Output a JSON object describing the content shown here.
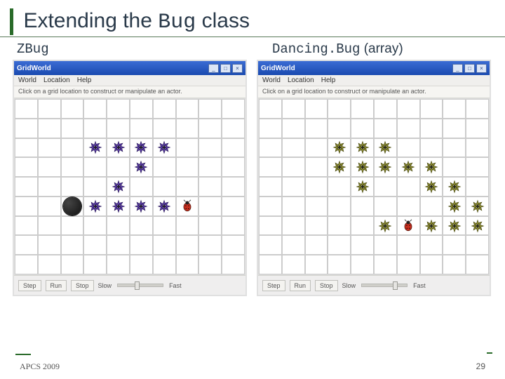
{
  "title_pre": "Extending the ",
  "title_code": "Bug",
  "title_post": " class",
  "left_label": "ZBug",
  "right_label_code": "Dancing.Bug",
  "right_label_paren": " (array)",
  "app": {
    "title": "GridWorld",
    "menu": {
      "m1": "World",
      "m2": "Location",
      "m3": "Help"
    },
    "hint": "Click on a grid location to construct or manipulate an actor.",
    "btn_step": "Step",
    "btn_run": "Run",
    "btn_stop": "Stop",
    "lbl_slow": "Slow",
    "lbl_fast": "Fast",
    "win_min": "_",
    "win_max": "□",
    "win_close": "×"
  },
  "footer": {
    "left": "APCS 2009",
    "right": "29"
  },
  "chart_data": {
    "type": "table",
    "note": "Two GridWorld windows, each a 10-col grid. Actor positions by (col,row).",
    "left_grid": {
      "cols": 10,
      "rows": 9,
      "flowers_purple": [
        [
          3,
          2
        ],
        [
          4,
          2
        ],
        [
          5,
          2
        ],
        [
          6,
          2
        ],
        [
          5,
          3
        ],
        [
          4,
          4
        ],
        [
          3,
          5
        ],
        [
          4,
          5
        ],
        [
          5,
          5
        ],
        [
          6,
          5
        ]
      ],
      "bug_red": [
        7,
        5
      ],
      "rock_black": [
        2,
        5
      ]
    },
    "right_grid": {
      "cols": 10,
      "rows": 9,
      "flowers_olive": [
        [
          3,
          2
        ],
        [
          4,
          2
        ],
        [
          5,
          2
        ],
        [
          3,
          3
        ],
        [
          4,
          3
        ],
        [
          5,
          3
        ],
        [
          6,
          3
        ],
        [
          7,
          3
        ],
        [
          4,
          4
        ],
        [
          7,
          4
        ],
        [
          8,
          4
        ],
        [
          5,
          6
        ],
        [
          7,
          6
        ],
        [
          8,
          6
        ],
        [
          9,
          6
        ],
        [
          8,
          5
        ],
        [
          9,
          5
        ]
      ],
      "bug_red": [
        6,
        6
      ]
    }
  }
}
